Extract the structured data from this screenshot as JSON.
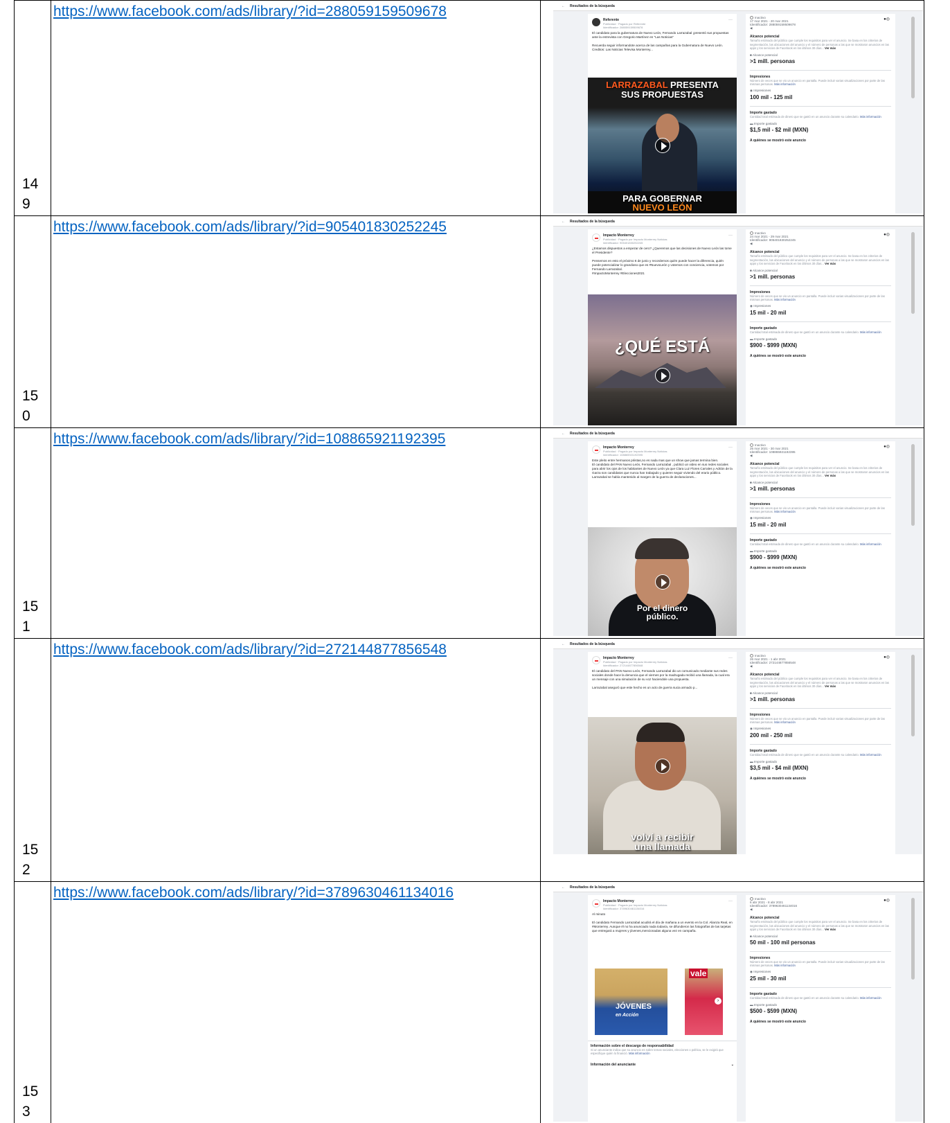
{
  "common": {
    "back_label": "Resultados de la búsqueda",
    "status": "Inactivo",
    "reach_title": "Alcance potencial",
    "reach_desc": "Tamaño estimado del público que cumple los requisitos para ver el anuncio. Se basa en los criterios de segmentación, las ubicaciones del anuncio y el número de personas a las que se mostraron anuncios en las apps y los servicios de Facebook en los últimos 30 días...",
    "reach_more": "Ver más",
    "reach_label": "Alcance potencial",
    "impr_title": "Impresiones",
    "impr_desc": "Número de veces que se vio un anuncio en pantalla. Puede incluir varias visualizaciones por parte de las mismas personas.",
    "impr_more": "Más información",
    "impr_label": "Impresiones",
    "spend_title": "Importe gastado",
    "spend_desc": "Cantidad total estimada de dinero que se gastó en un anuncio durante su calendario.",
    "spend_more": "Más información",
    "spend_label": "Importe gastado",
    "who_label": "A quiénes se mostró este anuncio",
    "paid_prefix": "Publicidad · Pagado por"
  },
  "rows": [
    {
      "num": "149",
      "num_a": "14",
      "num_b": "9",
      "url": "https://www.facebook.com/ads/library/?id=288059159509678",
      "page_name": "Referente",
      "paid_by": "Referente",
      "ad_id": "Identificador: 288059159509678",
      "text": "El candidato para la gubernatura de Nuevo León, Fernando Larrazabal ¡presentó sus propuestas ante la entrevista con Gregorio Martínez en \"Las Noticias\"\n\nRecuerda seguir informandote acerca de las campañas para la Gubernatura de Nuevo León.\nCreditos: Las Noticias Televisa Monterrey...",
      "overlay_top_a": "LARRAZABAL",
      "overlay_top_b": "PRESENTA",
      "overlay_top_c": "SUS PROPUESTAS",
      "overlay_bottom_a": "PARA GOBERNAR",
      "overlay_bottom_b": "NUEVO LEÓN",
      "dates": "17 mar 2021 - 20 mar 2021",
      "identifier": "Identificador: 288059159509678",
      "reach": ">1 mill. personas",
      "impressions": "100 mil - 125 mil",
      "spend": "$1,5 mil - $2 mil (MXN)"
    },
    {
      "num": "150",
      "num_a": "15",
      "num_b": "0",
      "url": "https://www.facebook.com/ads/library/?id=905401830252245",
      "page_name": "Impacto Monterrey",
      "paid_by": "Impacto Monterrey Noticias",
      "ad_id": "Identificador: 905401830252245",
      "text": "¿Estamos dispuestos a empezar de cero? ¿Queremos que las decisiones de Nuevo León las tome el Presidente?\n\nPensemos en esto el próximo 6 de junio y recordemos quién puede hacer la diferencia, quién puede potencializar lo grandioso que es #NuevoLeón y votemos con conciencia, votemos por Fernando Larrazabal.\n#ImpactoMonterrey #Elecciones2021",
      "overlay_mid": "¿QUÉ ESTÁ",
      "dates": "24 mar 2021 - 29 mar 2021",
      "identifier": "Identificador: 905401830252245",
      "reach": ">1 mill. personas",
      "impressions": "15 mil - 20 mil",
      "spend": "$900 - $999 (MXN)"
    },
    {
      "num": "151",
      "num_a": "15",
      "num_b": "1",
      "url": "https://www.facebook.com/ads/library/?id=108865921192395",
      "page_name": "Impacto Monterrey",
      "paid_by": "Impacto Monterrey Noticias",
      "ad_id": "Identificador: 108865921192395",
      "text": "Este pleito entre hermanos priistas,no es nada mas que un show que jamas termina bien.\nEl candidato del PAN Nuevo León, Fernando Larrazabal , publicó un video en sus redes sociales para abrir los ojos de los habitantes de Nuevo León ya que Clara Luz Flores Carrales y Adrián de la Garza son candidatos que nunca han trabajado y quieren seguir viviendo del erario público.\nLarrazabal se había mantenido al margen de la guerra de declaraciones...",
      "overlay_bottom_a": "Por el dinero",
      "overlay_bottom_b": "público.",
      "dates": "25 mar 2021 - 30 mar 2021",
      "identifier": "Identificador: 108865921192395",
      "reach": ">1 mill. personas",
      "impressions": "15 mil - 20 mil",
      "spend": "$900 - $999 (MXN)"
    },
    {
      "num": "152",
      "num_a": "15",
      "num_b": "2",
      "url": "https://www.facebook.com/ads/library/?id=272144877856548",
      "page_name": "Impacto Monterrey",
      "paid_by": "Impacto Monterrey Noticias",
      "ad_id": "Identificador: 272144877856548",
      "text": "El candidato del PAN Nuevo León, Fernando Larrazabal dio un comunicado mediante sus redes sociales donde hace la denuncia que el viernes por la madrugada recibió una llamada, la cual era un mensaje con una simulación de su voz haciendole una propuesta.\n\nLarrazabal aseguró que este hecho es un acto de guerra sucia armado p...",
      "overlay_bottom_a": "volví a recibir",
      "overlay_bottom_b": "una llamada",
      "dates": "26 mar 2021 - 1 abr 2021",
      "identifier": "Identificador: 272144877856548",
      "reach": ">1 mill. personas",
      "impressions": "200 mil - 250 mil",
      "spend": "$3,5 mil - $4 mil (MXN)"
    },
    {
      "num": "153",
      "num_a": "15",
      "num_b": "3",
      "url": "https://www.facebook.com/ads/library/?id=3789630461134016",
      "page_name": "Impacto Monterrey",
      "paid_by": "Impacto Monterrey Noticias",
      "ad_id": "Identificador: 3789630461134016",
      "text": "Al minuto\n\nEl candidato Fernando Larrazabal acudirá el día de mañana a un evento en la Col. Alianza Real, en #Monterrey. Aunque él no ha anunciado nada todavía, se difundieron las fotografías de las tarjetas que entregará a mujeres y jóvenes,mencionadas alguna vez en campaña.",
      "card_label": "JÓVENES",
      "card_label_b": "en Acción",
      "card2_label": "vale",
      "disclaimer_title": "Información sobre el descargo de responsabilidad",
      "disclaimer_desc": "Si un anunciante indica que su anuncio es sobre temas sociales, elecciones o política, se le exigirá que especifique quién lo financió.",
      "disclaimer_more": "Más información",
      "advertiser_info": "Información del anunciante",
      "dates": "6 abr 2021 - 8 abr 2021",
      "identifier": "Identificador: 3789630461134016",
      "reach": "50 mil - 100 mil personas",
      "impressions": "25 mil - 30 mil",
      "spend": "$500 - $599 (MXN)"
    }
  ]
}
